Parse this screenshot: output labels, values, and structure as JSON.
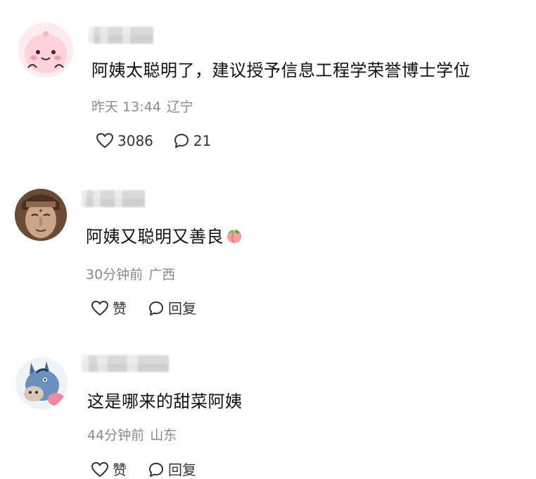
{
  "comments": [
    {
      "avatar": "pink-blob-avatar",
      "text": "阿姨太聪明了，建议授予信息工程学荣誉博士学位",
      "time": "昨天 13:44",
      "location": "辽宁",
      "likes": "3086",
      "replies": "21"
    },
    {
      "avatar": "statue-face-avatar",
      "text": "阿姨又聪明又善良",
      "emoji": "peach-emoji",
      "time": "30分钟前",
      "location": "广西",
      "likes": "赞",
      "replies": "回复"
    },
    {
      "avatar": "blue-donkey-avatar",
      "text": "这是哪来的甜菜阿姨",
      "time": "44分钟前",
      "location": "山东",
      "likes": "赞",
      "replies": "回复"
    }
  ]
}
